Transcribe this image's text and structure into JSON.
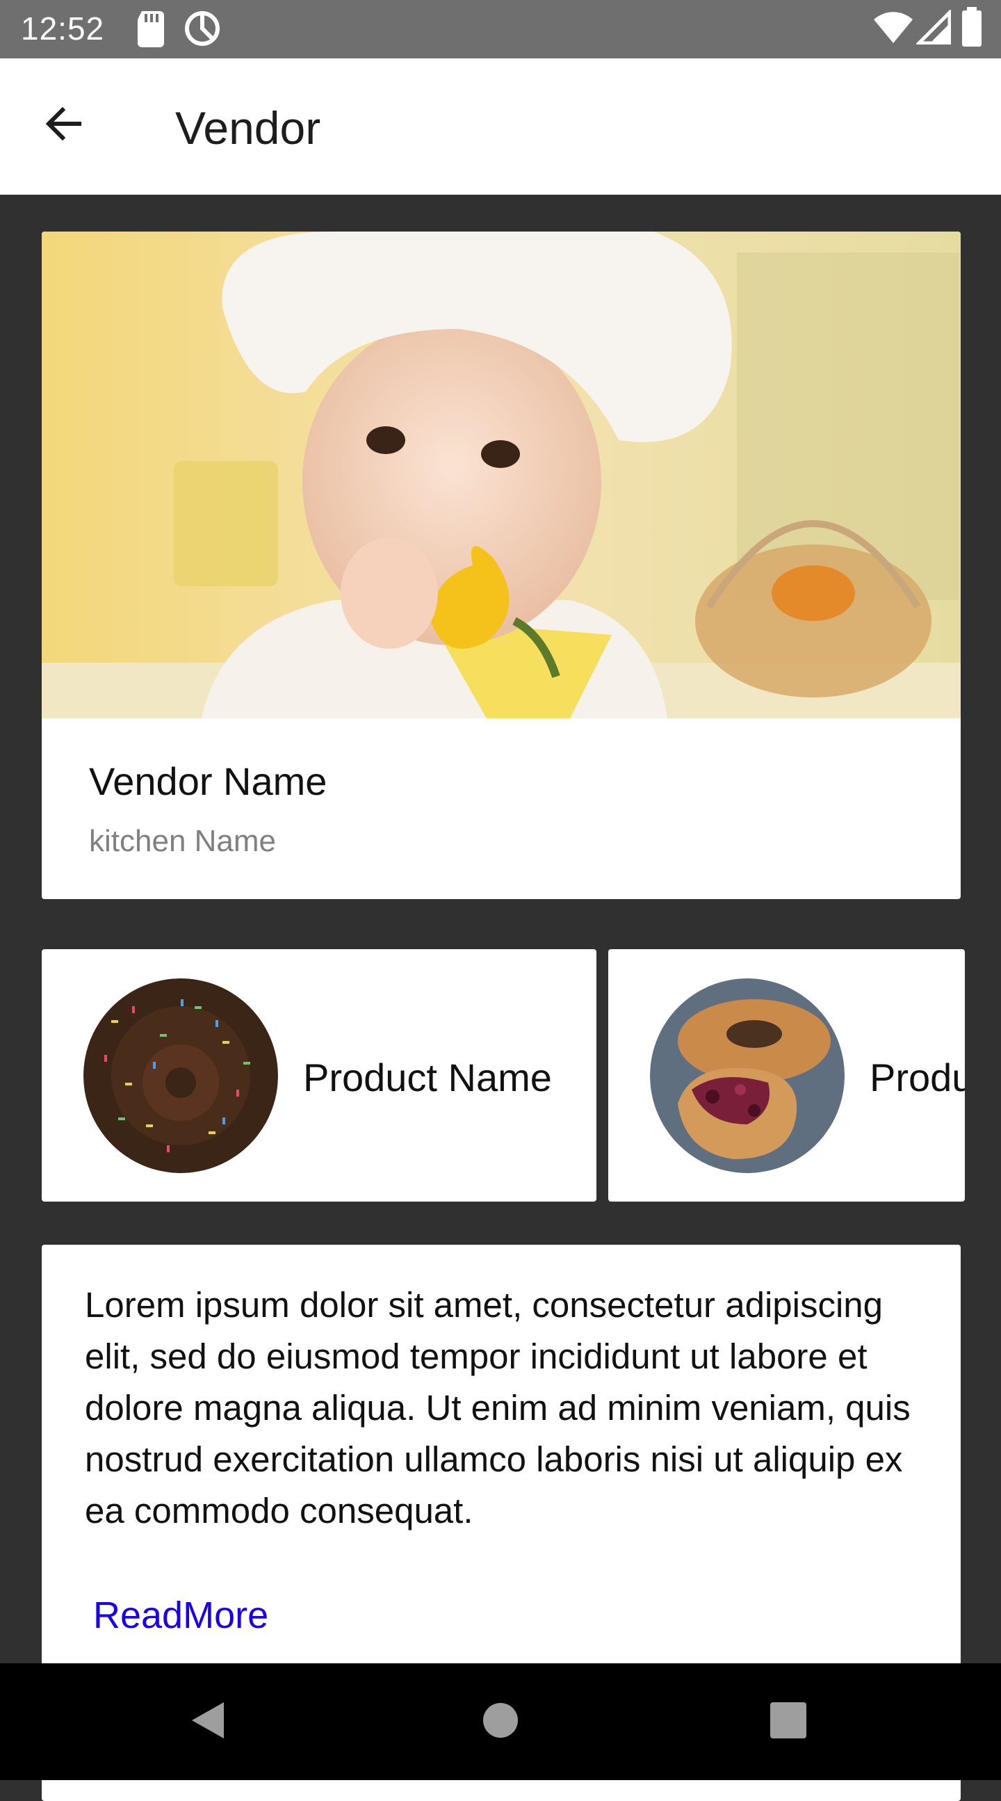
{
  "status_bar": {
    "time": "12:52",
    "left_icons": [
      "sd-card-icon",
      "data-saver-icon"
    ],
    "right_icons": [
      "wifi-icon",
      "cell-signal-icon",
      "battery-icon"
    ]
  },
  "app_bar": {
    "back_icon": "arrow-left-icon",
    "title": "Vendor"
  },
  "vendor": {
    "image": "chef-child-photo",
    "name": "Vendor Name",
    "kitchen": "kitchen Name"
  },
  "products": [
    {
      "name": "Product Name",
      "image": "sprinkle-donut-photo"
    },
    {
      "name": "Produ",
      "image": "berry-pastry-photo"
    }
  ],
  "description": {
    "text": "Lorem ipsum dolor sit amet, consectetur adipiscing elit, sed do eiusmod tempor incididunt ut labore et dolore magna aliqua. Ut enim ad minim veniam, quis nostrud exercitation ullamco laboris nisi ut aliquip ex ea commodo consequat.",
    "read_more": "ReadMore"
  },
  "nav_bar": {
    "buttons": [
      "back-triangle-icon",
      "home-circle-icon",
      "recents-square-icon"
    ]
  },
  "colors": {
    "status_bar": "#6f6f6f",
    "background": "#303030",
    "card": "#ffffff",
    "link": "#1a00e8"
  }
}
